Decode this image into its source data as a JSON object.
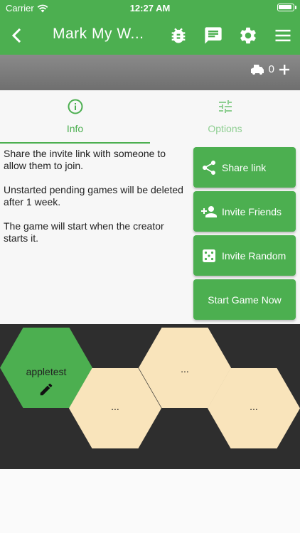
{
  "status": {
    "carrier": "Carrier",
    "time": "12:27 AM"
  },
  "appbar": {
    "title": "Mark My W...",
    "icons": [
      "back-arrow-icon",
      "bug-icon",
      "chat-icon",
      "gear-icon",
      "menu-icon"
    ]
  },
  "strip": {
    "player_count": "0"
  },
  "tabs": [
    {
      "label": "Info",
      "icon": "info-icon",
      "active": true
    },
    {
      "label": "Options",
      "icon": "tune-icon",
      "active": false
    }
  ],
  "info": {
    "paragraphs": [
      "Share the invite link with someone to allow them to join.",
      "Unstarted pending games will be deleted after 1 week.",
      "The game will start when the creator starts it."
    ]
  },
  "buttons": {
    "share": "Share link",
    "invite_friends": "Invite Friends",
    "invite_random": "Invite Random",
    "start": "Start Game Now"
  },
  "board": {
    "player": "appletest",
    "slots": [
      "...",
      "...",
      "..."
    ]
  },
  "colors": {
    "accent": "#4caf50",
    "slot": "#f9e4bb",
    "board": "#2e2e2e",
    "strip": "#7d7d7d"
  }
}
